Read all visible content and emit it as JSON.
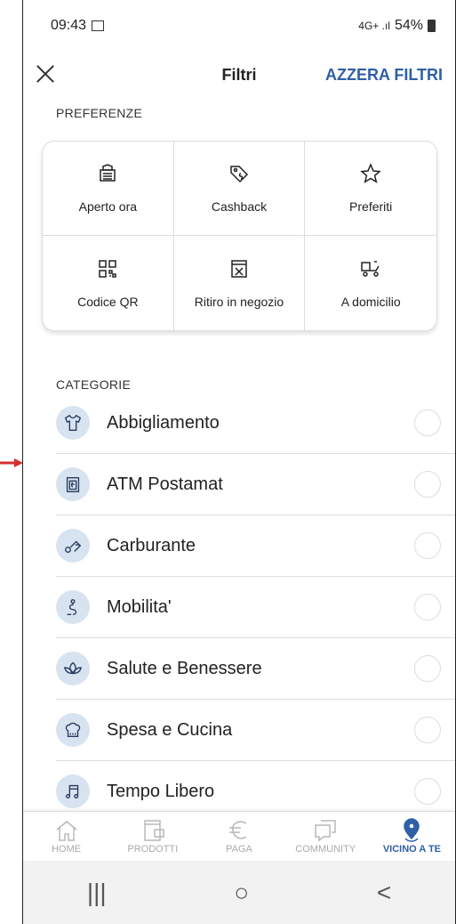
{
  "status": {
    "time": "09:43",
    "network": "4G+ .ıl",
    "battery": "54%"
  },
  "header": {
    "title": "Filtri",
    "reset": "AZZERA FILTRI"
  },
  "preferences": {
    "title": "PREFERENZE",
    "items": [
      {
        "label": "Aperto ora",
        "icon": "open-store-icon"
      },
      {
        "label": "Cashback",
        "icon": "cashback-tag-icon"
      },
      {
        "label": "Preferiti",
        "icon": "star-icon"
      },
      {
        "label": "Codice QR",
        "icon": "qr-code-icon"
      },
      {
        "label": "Ritiro in negozio",
        "icon": "store-pickup-icon"
      },
      {
        "label": "A domicilio",
        "icon": "delivery-scooter-icon"
      }
    ]
  },
  "categories": {
    "title": "CATEGORIE",
    "items": [
      {
        "label": "Abbigliamento",
        "icon": "tshirt-icon"
      },
      {
        "label": "ATM Postamat",
        "icon": "atm-icon"
      },
      {
        "label": "Carburante",
        "icon": "fuel-icon"
      },
      {
        "label": "Mobilita'",
        "icon": "route-icon"
      },
      {
        "label": "Salute e Benessere",
        "icon": "lotus-icon"
      },
      {
        "label": "Spesa e Cucina",
        "icon": "chef-hat-icon"
      },
      {
        "label": "Tempo Libero",
        "icon": "music-icon"
      }
    ]
  },
  "nav": {
    "items": [
      {
        "label": "HOME",
        "icon": "home-icon"
      },
      {
        "label": "PRODOTTI",
        "icon": "wallet-icon"
      },
      {
        "label": "PAGA",
        "icon": "euro-icon"
      },
      {
        "label": "COMMUNITY",
        "icon": "chat-icon"
      },
      {
        "label": "VICINO A TE",
        "icon": "location-pin-icon",
        "active": true
      }
    ]
  },
  "system_nav": {
    "recent": "|||",
    "home": "○",
    "back": "<"
  },
  "colors": {
    "accent": "#2f5fa6",
    "category_bg": "#d8e3f1",
    "arrow": "#d32f2f"
  }
}
